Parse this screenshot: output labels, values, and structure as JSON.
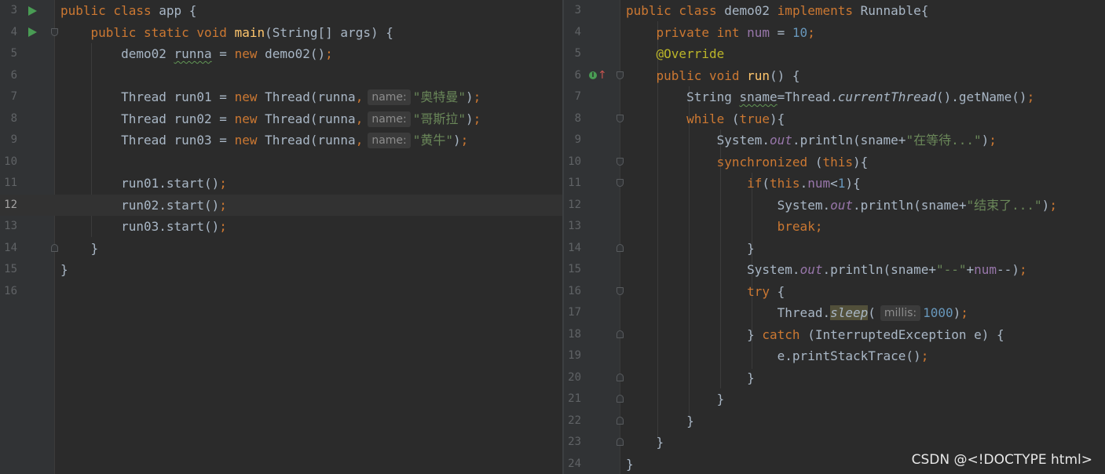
{
  "left": {
    "lines": [
      {
        "n": "3"
      },
      {
        "n": "4"
      },
      {
        "n": "5"
      },
      {
        "n": "6"
      },
      {
        "n": "7"
      },
      {
        "n": "8"
      },
      {
        "n": "9"
      },
      {
        "n": "10"
      },
      {
        "n": "11"
      },
      {
        "n": "12"
      },
      {
        "n": "13"
      },
      {
        "n": "14"
      },
      {
        "n": "15"
      },
      {
        "n": "16"
      }
    ],
    "hint_label": "name:",
    "name1": "\"奥特曼\"",
    "name2": "\"哥斯拉\"",
    "name3": "\"黄牛\""
  },
  "right": {
    "lines": [
      {
        "n": "3"
      },
      {
        "n": "4"
      },
      {
        "n": "5"
      },
      {
        "n": "6"
      },
      {
        "n": "7"
      },
      {
        "n": "8"
      },
      {
        "n": "9"
      },
      {
        "n": "10"
      },
      {
        "n": "11"
      },
      {
        "n": "12"
      },
      {
        "n": "13"
      },
      {
        "n": "14"
      },
      {
        "n": "15"
      },
      {
        "n": "16"
      },
      {
        "n": "17"
      },
      {
        "n": "18"
      },
      {
        "n": "19"
      },
      {
        "n": "20"
      },
      {
        "n": "21"
      },
      {
        "n": "22"
      },
      {
        "n": "23"
      },
      {
        "n": "24"
      }
    ],
    "hint_label": "millis:",
    "str_wait": "\"在等待...\"",
    "str_end": "\"结束了...\"",
    "str_sep": "\"--\""
  },
  "watermark": "CSDN @<!DOCTYPE html>",
  "colors": {
    "background": "#2b2b2b",
    "keyword": "#cc7832",
    "string": "#6a8759",
    "number": "#6897bb",
    "method": "#ffc66d",
    "field": "#9876aa",
    "run_icon": "#499c54"
  },
  "icons": {
    "run": "run-triangle-icon",
    "fold": "fold-marker-icon",
    "override": "override-method-icon"
  }
}
